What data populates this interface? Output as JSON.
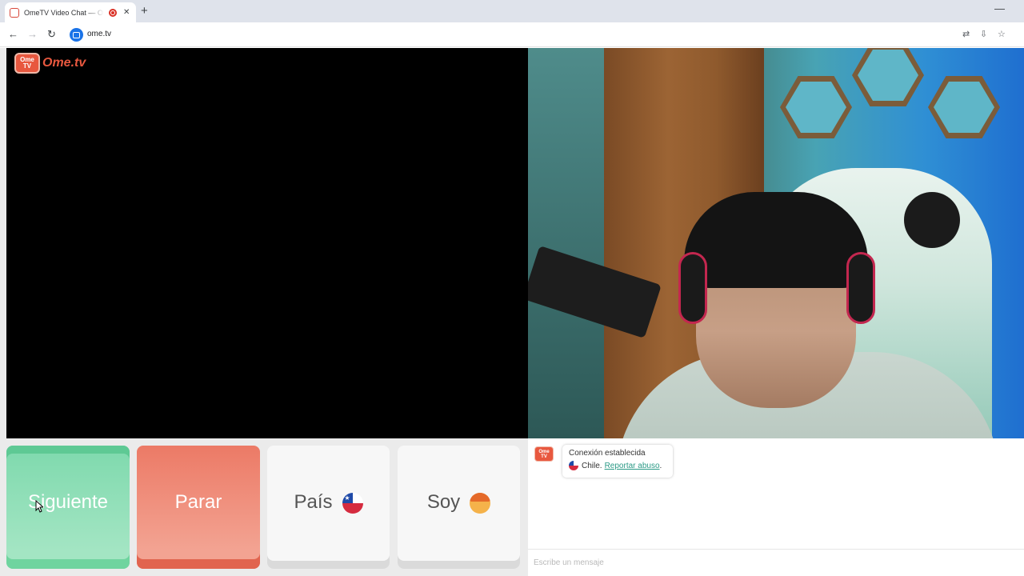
{
  "browser": {
    "tab_title": "OmeTV Video Chat — Omegle alternative",
    "new_tab_symbol": "+",
    "close_symbol": "✕",
    "minimize_symbol": "—",
    "url": "ome.tv",
    "icons": {
      "back": "←",
      "forward": "→",
      "reload": "↻",
      "translate": "⇄",
      "install": "⇩",
      "star": "☆"
    }
  },
  "logo": {
    "tv_text": "Ome TV",
    "text": "Ome.tv"
  },
  "controls": {
    "next_label": "Siguiente",
    "stop_label": "Parar",
    "country_label": "País",
    "country_flag": "chile-flag-icon",
    "gender_label": "Soy",
    "gender_icon": "boy-icon"
  },
  "chat": {
    "avatar_text": "Ome TV",
    "status_message": "Conexión establecida",
    "country_text": "Chile.",
    "report_link": "Reportar abuso",
    "report_suffix": ".",
    "input_placeholder": "Escribe un mensaje"
  },
  "colors": {
    "next_button": "#7ed9ad",
    "stop_button": "#ec7a66",
    "brand": "#e8583f",
    "link": "#2b9a86"
  }
}
